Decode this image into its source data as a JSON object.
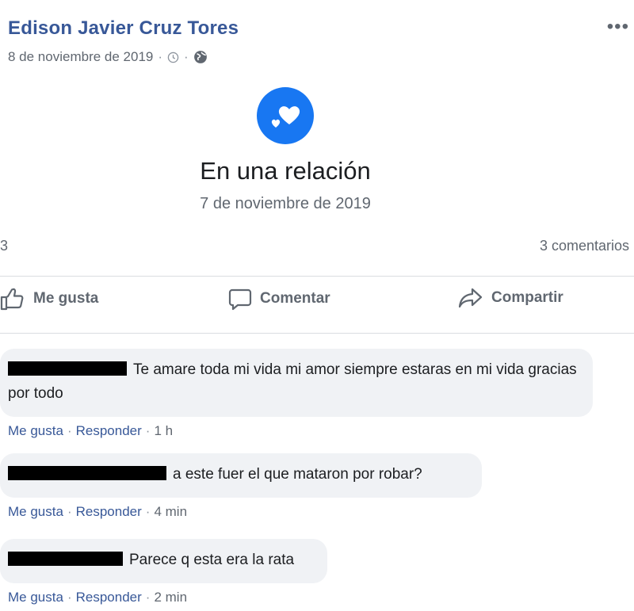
{
  "post": {
    "author": "Edison Javier Cruz Tores",
    "date": "8 de noviembre de 2019",
    "separator": "·",
    "more_label": "•••"
  },
  "event": {
    "icon": "hearts-icon",
    "title": "En una relación",
    "date": "7 de noviembre de 2019"
  },
  "stats": {
    "reactions_count": "3",
    "comments_count": "3 comentarios"
  },
  "actions": {
    "like": "Me gusta",
    "comment": "Comentar",
    "share": "Compartir"
  },
  "comments": [
    {
      "text": "Te amare toda mi vida mi amor siempre estaras en mi vida gracias por todo",
      "like": "Me gusta",
      "reply": "Responder",
      "time": "1 h"
    },
    {
      "text": "a este fuer el que mataron por robar?",
      "like": "Me gusta",
      "reply": "Responder",
      "time": "4 min"
    },
    {
      "text": "Parece q esta era la rata",
      "like": "Me gusta",
      "reply": "Responder",
      "time": "2 min"
    }
  ],
  "colors": {
    "brand_blue": "#1877f2",
    "link_blue": "#385898",
    "bubble_bg": "#f0f2f5",
    "muted_text": "#606770"
  }
}
